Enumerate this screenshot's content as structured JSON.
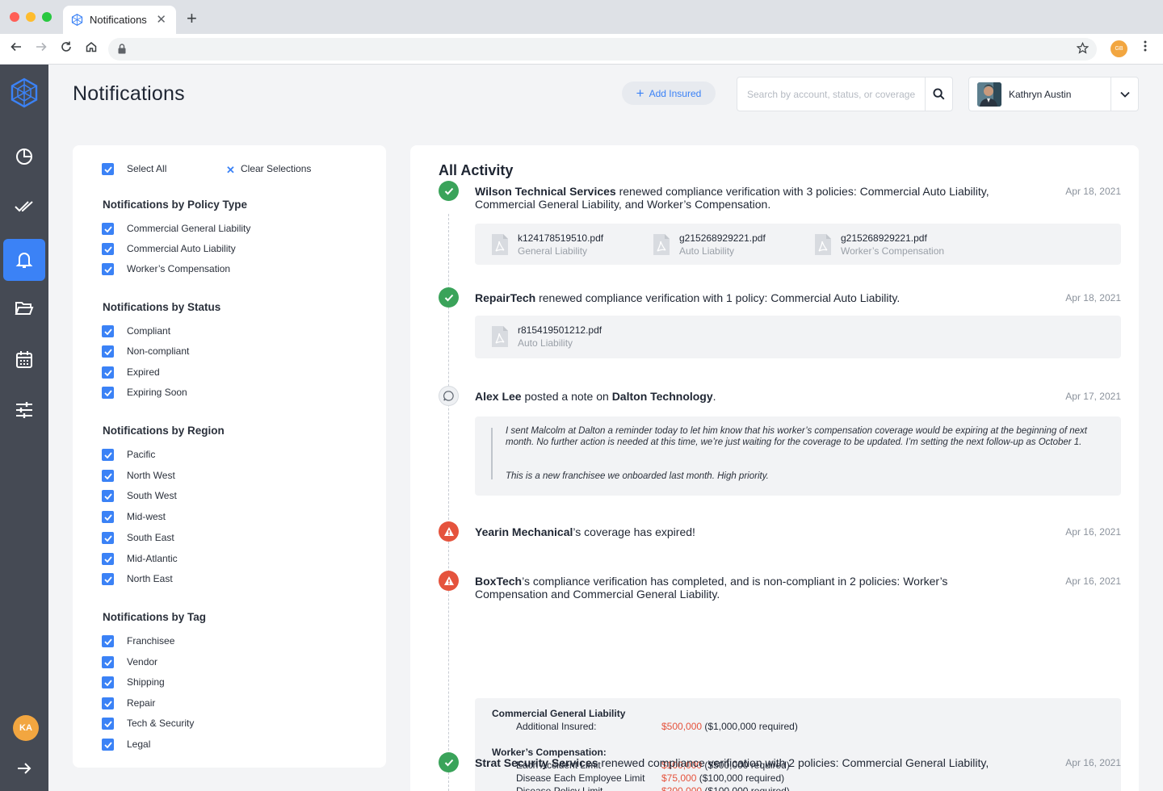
{
  "browser": {
    "tab_title": "Notifications",
    "tab_close": "✕",
    "new_tab": "+",
    "profile_initials": "GB"
  },
  "sidebar": {
    "items": [
      {
        "icon": "pie-chart-icon",
        "active": false
      },
      {
        "icon": "double-check-icon",
        "active": false
      },
      {
        "icon": "bell-icon",
        "active": true
      },
      {
        "icon": "folder-icon",
        "active": false
      },
      {
        "icon": "calendar-icon",
        "active": false
      },
      {
        "icon": "sliders-icon",
        "active": false
      }
    ],
    "avatar_initials": "KA"
  },
  "header": {
    "title": "Notifications",
    "add_insured_label": "Add Insured",
    "search_placeholder": "Search by account, status, or coverage",
    "user_name": "Kathryn Austin"
  },
  "filters": {
    "select_all": "Select All",
    "clear_selections": "Clear Selections",
    "groups": [
      {
        "heading": "Notifications by Policy Type",
        "items": [
          "Commercial General Liability",
          "Commercial Auto Liability",
          "Worker’s Compensation"
        ]
      },
      {
        "heading": "Notifications by Status",
        "items": [
          "Compliant",
          "Non-compliant",
          "Expired",
          "Expiring Soon"
        ]
      },
      {
        "heading": "Notifications by Region",
        "items": [
          "Pacific",
          "North West",
          "South West",
          "Mid-west",
          "South East",
          "Mid-Atlantic",
          "North East"
        ]
      },
      {
        "heading": "Notifications by Tag",
        "items": [
          "Franchisee",
          "Vendor",
          "Shipping",
          "Repair",
          "Tech & Security",
          "Legal"
        ]
      }
    ]
  },
  "activity": {
    "title": "All Activity",
    "events": [
      {
        "status": "ok",
        "subject": "Wilson Technical Services",
        "text": " renewed compliance verification with 3 policies: Commercial Auto Liability, Commercial General Liability, and Worker’s Compensation.",
        "date": "Apr 18, 2021",
        "files": [
          {
            "name": "k124178519510.pdf",
            "type": "General Liability"
          },
          {
            "name": "g215268929221.pdf",
            "type": "Auto Liability"
          },
          {
            "name": "g215268929221.pdf",
            "type": "Worker’s Compensation"
          }
        ]
      },
      {
        "status": "ok",
        "subject": "RepairTech",
        "text": " renewed compliance verification with 1 policy: Commercial Auto Liability.",
        "date": "Apr 18, 2021",
        "files": [
          {
            "name": "r815419501212.pdf",
            "type": "Auto Liability"
          }
        ]
      },
      {
        "status": "note",
        "subject": "Alex Lee",
        "text": " posted a note on ",
        "object": "Dalton Technology",
        "suffix": ".",
        "date": "Apr 17, 2021",
        "note": [
          "I sent Malcolm at Dalton a reminder today to let him know that his worker’s compensation coverage would be expiring at the beginning of next month. No further action is needed at this time, we’re just waiting for the coverage to be updated. I’m setting the next follow-up as October 1.",
          "This is a new franchisee we onboarded last month. High priority."
        ]
      },
      {
        "status": "warn",
        "subject": "Yearin Mechanical",
        "text": "’s coverage has expired!",
        "date": "Apr 16, 2021"
      },
      {
        "status": "warn",
        "subject": "BoxTech",
        "text": "’s compliance verification has completed, and is non-compliant in 2 policies: Worker’s Compensation and Commercial General Liability.",
        "date": "Apr 16, 2021",
        "details": [
          {
            "heading": "Commercial General Liability",
            "rows": [
              {
                "label": "Additional Insured:",
                "value": "$500,000",
                "required": "($1,000,000 required)"
              }
            ]
          },
          {
            "heading": "Worker’s Compensation:",
            "rows": [
              {
                "label": "Each Accident Limit",
                "value": "$100,000",
                "required": "($500,000 required)"
              },
              {
                "label": "Disease Each Employee Limit",
                "value": "$75,000",
                "required": "($100,000 required)"
              },
              {
                "label": "Disease Policy Limit",
                "value": "$200,000",
                "required": "($100,000 required)"
              }
            ]
          }
        ]
      },
      {
        "status": "ok",
        "subject": "Strat Security Services",
        "text": " renewed compliance verification with 2 policies: Commercial General Liability,",
        "date": "Apr 16, 2021"
      }
    ]
  },
  "colors": {
    "accent": "#3b82f6",
    "sidebar": "#454a54",
    "success": "#3aa35a",
    "danger": "#e5533d"
  }
}
